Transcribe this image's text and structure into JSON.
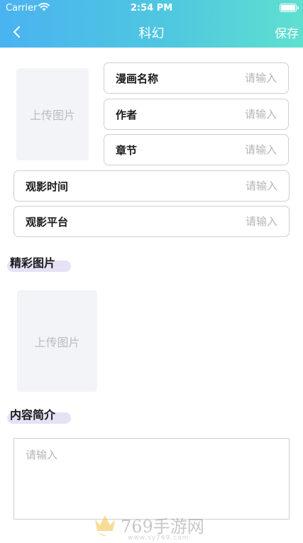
{
  "status_bar": {
    "carrier": "Carrier",
    "time": "2:54 PM"
  },
  "nav": {
    "title": "科幻",
    "save_label": "保存"
  },
  "cover_upload": {
    "label": "上传图片"
  },
  "fields": [
    {
      "label": "漫画名称",
      "placeholder": "请输入"
    },
    {
      "label": "作者",
      "placeholder": "请输入"
    },
    {
      "label": "章节",
      "placeholder": "请输入"
    },
    {
      "label": "观影时间",
      "placeholder": "请输入"
    },
    {
      "label": "观影平台",
      "placeholder": "请输入"
    }
  ],
  "gallery_section": {
    "title": "精彩图片",
    "upload_label": "上传图片"
  },
  "intro_section": {
    "title": "内容简介",
    "placeholder": "请输入"
  },
  "watermark": {
    "text": "769手游网",
    "url": "www.sy769.com"
  },
  "colors": {
    "header_start": "#4ab3f0",
    "header_end": "#5fe0cf",
    "pill": "#e6e1f5"
  }
}
